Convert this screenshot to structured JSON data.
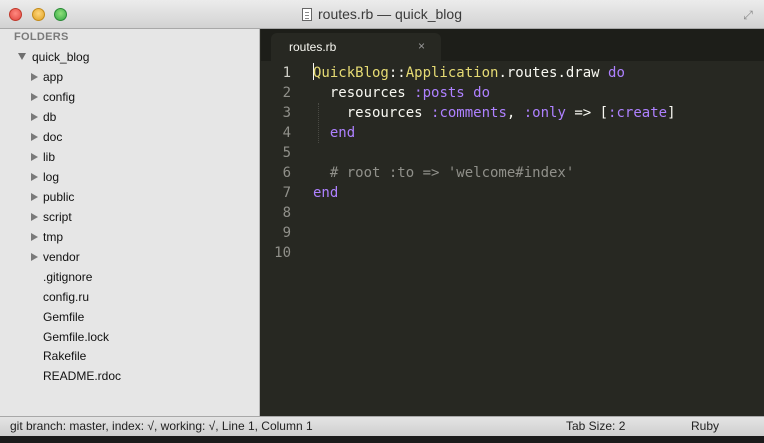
{
  "window": {
    "title": "routes.rb — quick_blog"
  },
  "sidebar": {
    "heading": "FOLDERS",
    "root": "quick_blog",
    "folders": [
      "app",
      "config",
      "db",
      "doc",
      "lib",
      "log",
      "public",
      "script",
      "tmp",
      "vendor"
    ],
    "files": [
      ".gitignore",
      "config.ru",
      "Gemfile",
      "Gemfile.lock",
      "Rakefile",
      "README.rdoc"
    ]
  },
  "tabs": [
    {
      "label": "routes.rb",
      "close": "×"
    }
  ],
  "editor": {
    "line_numbers": [
      "1",
      "2",
      "3",
      "4",
      "5",
      "6",
      "7",
      "8",
      "9",
      "10"
    ],
    "line1": {
      "cls1": "QuickBlog",
      "sep": "::",
      "cls2": "Application",
      "rest": ".routes.draw ",
      "kw": "do"
    },
    "line2": {
      "indent": "  ",
      "method": "resources ",
      "sym": ":posts",
      "sp": " ",
      "kw": "do"
    },
    "line3": {
      "indent": "    ",
      "method": "resources ",
      "sym": ":comments",
      "punc1": ", ",
      "sym2": ":only",
      "punc2": " => [",
      "sym3": ":create",
      "punc3": "]"
    },
    "line4": {
      "indent": "  ",
      "kw": "end"
    },
    "line6": {
      "indent": "  ",
      "comment": "# root :to => 'welcome#index'"
    },
    "line7": {
      "kw": "end"
    }
  },
  "statusbar": {
    "left": "git branch: master, index: √, working: √, Line 1, Column 1",
    "tab_size": "Tab Size: 2",
    "syntax": "Ruby"
  },
  "colors": {
    "editor_bg": "#272822",
    "class_yellow": "#e6db74",
    "keyword_purple": "#ae81ff",
    "comment_gray": "#90908a"
  }
}
